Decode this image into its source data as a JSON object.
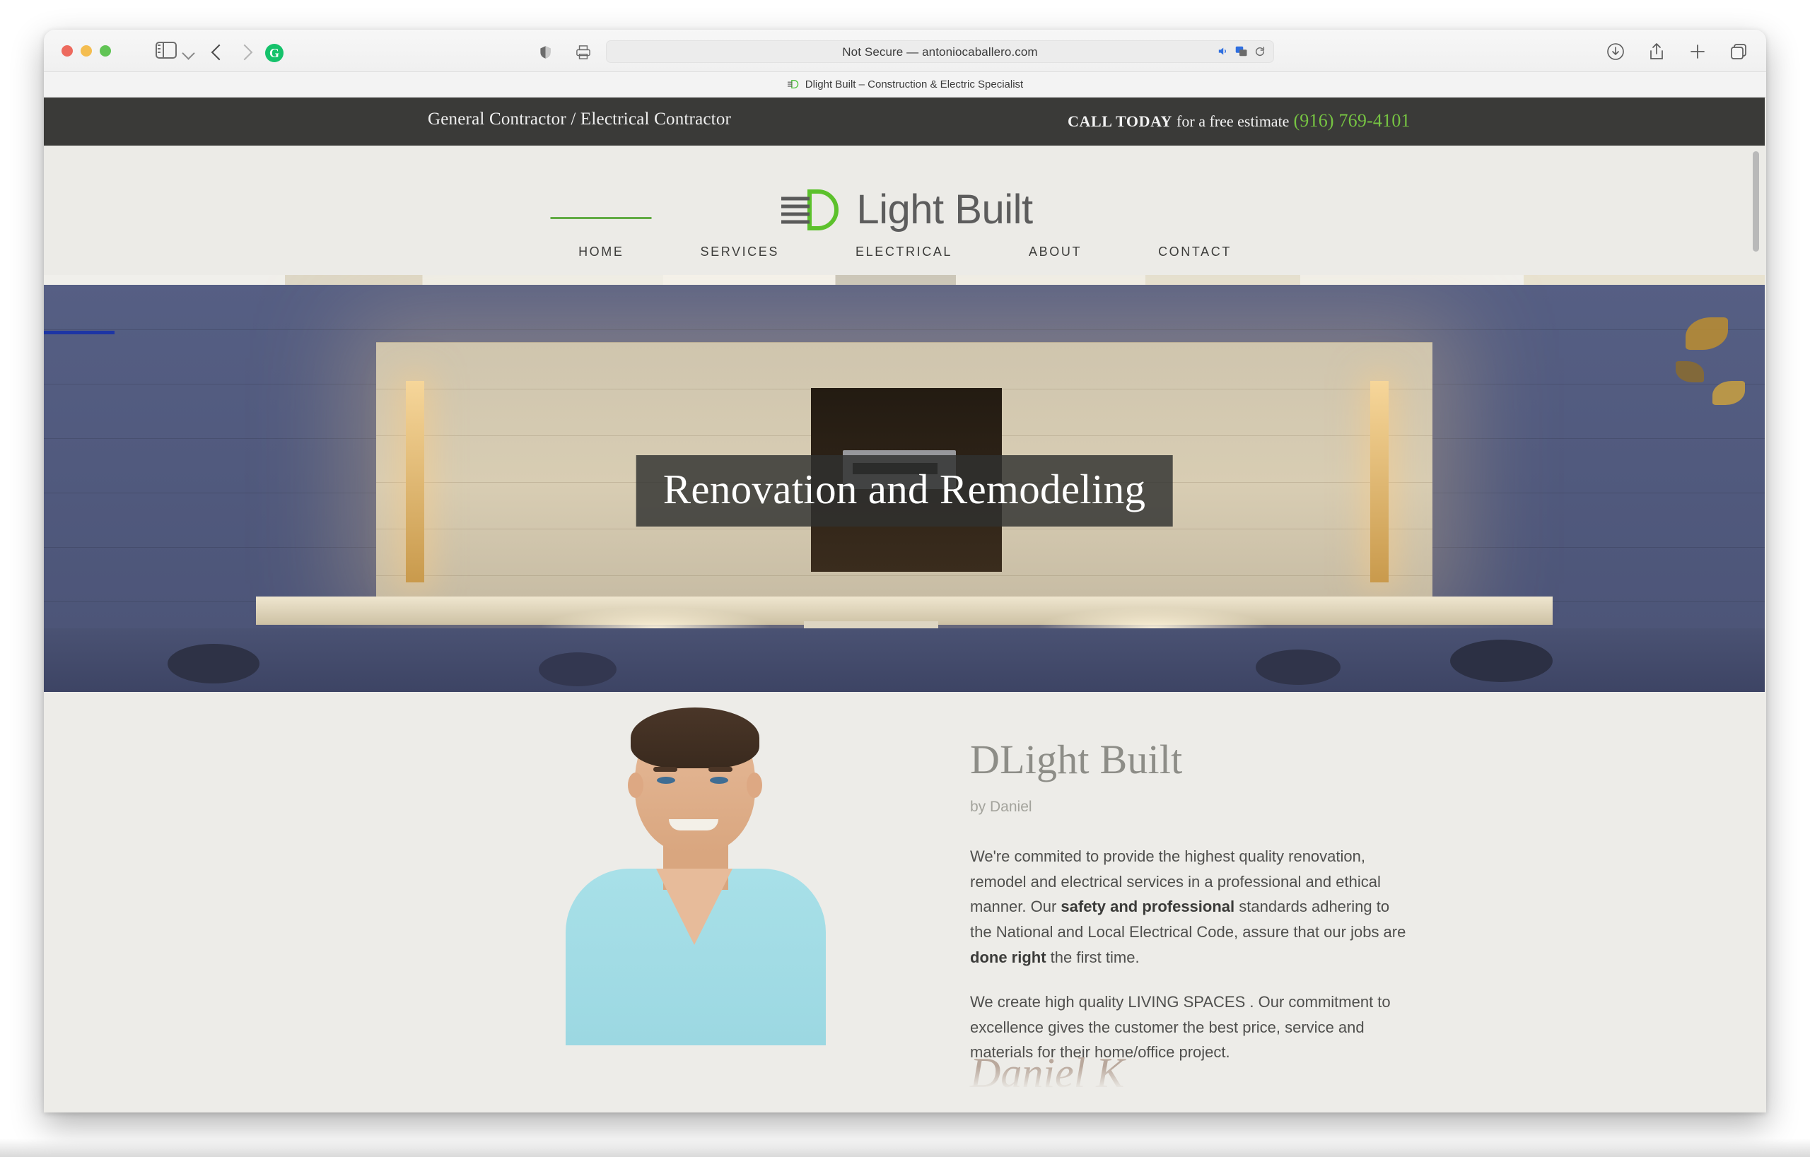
{
  "browser": {
    "traffic_lights": [
      "close",
      "minimize",
      "maximize"
    ],
    "url": "Not Secure — antoniocaballero.com",
    "tab_title": "Dlight Built – Construction & Electric Specialist",
    "icons": {
      "sidebar": "sidebar-icon",
      "tab_overview": "chevron-down-icon",
      "back": "back-arrow-icon",
      "forward": "forward-arrow-icon",
      "extension": "grammarly-icon",
      "extension_letter": "G",
      "shield": "privacy-shield-icon",
      "reader": "reader-icon",
      "audio": "audio-icon",
      "translate": "translate-icon",
      "reload": "reload-icon",
      "downloads": "download-icon",
      "share": "share-icon",
      "new_tab": "plus-icon",
      "tabs": "tabs-icon"
    }
  },
  "site": {
    "topbar": {
      "tagline": "General Contractor / Electrical Contractor",
      "call_label": "CALL TODAY",
      "call_sub": "for a free estimate",
      "phone": "(916) 769-4101",
      "phone_color": "#76c442",
      "background": "#3a3a38"
    },
    "logo": {
      "text": "Light Built",
      "mark": "dlight-plug-icon",
      "mark_color": "#5cc12c",
      "text_color": "#5d5d5d"
    },
    "nav": {
      "items": [
        {
          "label": "HOME",
          "active": true
        },
        {
          "label": "SERVICES",
          "active": false
        },
        {
          "label": "ELECTRICAL",
          "active": false
        },
        {
          "label": "ABOUT",
          "active": false
        },
        {
          "label": "CONTACT",
          "active": false
        }
      ],
      "active_underline_color": "#62ab44"
    },
    "hero": {
      "caption": "Renovation and Remodeling",
      "image_alt": "Modern house entrance at dusk with warm accent lighting"
    },
    "about": {
      "title": "DLight Built",
      "byline": "by Daniel",
      "paragraph1_a": "We're commited to provide the highest quality renovation, remodel and electrical services in a professional and ethical manner. Our ",
      "paragraph1_b": "safety and professional",
      "paragraph1_c": " standards adhering to the National and Local Electrical Code, assure that our jobs are ",
      "paragraph1_d": "done right",
      "paragraph1_e": " the first time.",
      "paragraph2_a": "We create high quality ",
      "paragraph2_b": "LIVING SPACES",
      "paragraph2_c": " . Our commitment to excellence gives the customer the best price, service and materials for their home/office project.",
      "signature": "Daniel K",
      "portrait_alt": "Portrait of Daniel in a light blue t-shirt",
      "background": "#edece8"
    }
  }
}
